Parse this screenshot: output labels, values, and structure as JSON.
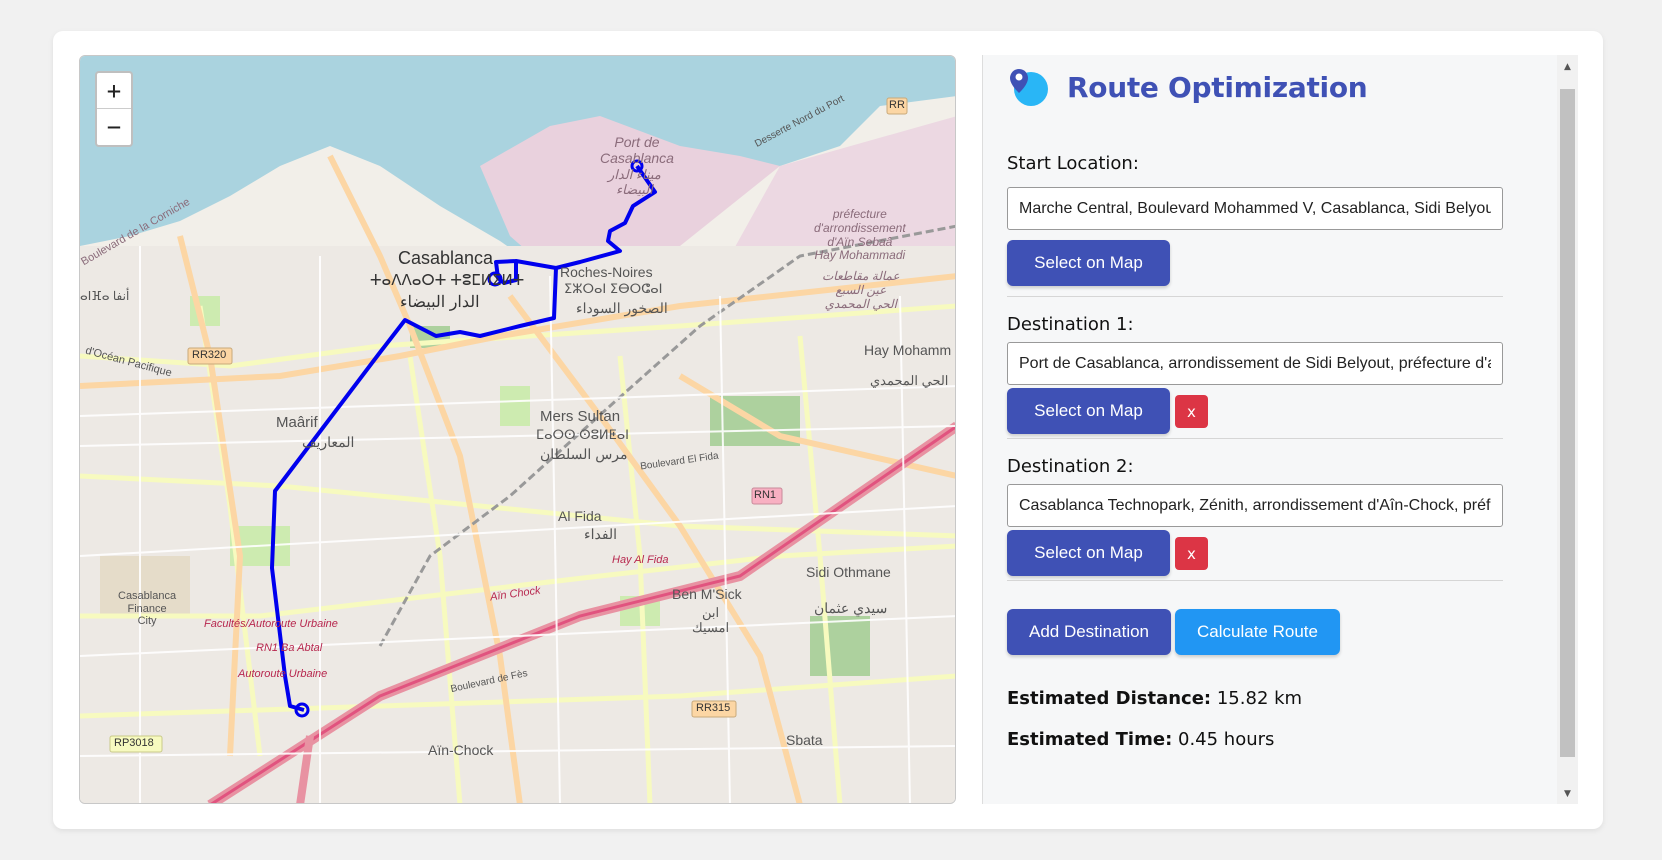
{
  "app": {
    "title": "Route Optimization",
    "accent_color": "#3f51b5",
    "secondary_color": "#2196f3",
    "danger_color": "#dc3545"
  },
  "map": {
    "zoom_in_label": "+",
    "zoom_out_label": "−",
    "route_color": "#0000ee",
    "labels": {
      "casablanca": "Casablanca",
      "casablanca_tifinagh": "ⵜⴰⴷⴷⴰⵔⵜ ⵜⵓⵎⵍⵉⵍⵜ",
      "casablanca_arabic": "الدار البيضاء",
      "port": "Port de\nCasablanca",
      "port_arabic": "ميناء الدار\nالبيضاء",
      "roches_noires": "Roches-Noires",
      "roches_tifinagh": "ⵉⵣⵔⴰⵏ ⵉⴱⵔⵛⴰⵏ",
      "roches_arabic": "الصخور السوداء",
      "mers_sultan": "Mers Sultan",
      "mers_tifinagh": "ⵎⴰⵔⵙ ⵙⵓⵍⵟⴰⵏ",
      "mers_arabic": "مرس السلطان",
      "maarif": "Maârif",
      "maarif_arabic": "المعاريف",
      "al_fida": "Al Fida",
      "al_fida_arabic": "الفداء",
      "ben_msick": "Ben M'Sick",
      "ben_msick_arabic": "ابن\nامسيك",
      "sidi_othmane": "Sidi Othmane",
      "sidi_othmane_arabic": "سيدي عثمان",
      "hay_mohammadi": "Hay Mohamm",
      "hay_mohammadi_arabic": "الحي المحمدي",
      "prefecture": "préfecture\nd'arrondissement\nd'Aïn Sebaâ\nHay Mohammadi",
      "prefecture_arabic": "عمالة مقاطعات\nعين السبع\nالحي المحمدي",
      "casablanca_finance": "Casablanca\nFinance\nCity",
      "ain_chock": "Aïn-Chock",
      "sbata": "Sbata",
      "rr320": "RR320",
      "rn1": "RN1",
      "rr315": "RR315",
      "rp3018": "RP3018",
      "rr": "RR",
      "ocean": "d'Océan Pacifique",
      "corniche": "Boulevard de la Corniche",
      "facultes": "Facultés/Autoroute Urbaine",
      "rn1_ba_abtal": "RN1 Ba Abtal",
      "autoroute": "Autoroute Urbaine",
      "ain_chock_road": "Aïn Chock",
      "hay_al_fida": "Hay Al Fida",
      "blvd_fes": "Boulevard de Fès",
      "desserte": "Desserte Nord du Port",
      "blvd_el_fida": "Boulevard El Fida",
      "anfa": "ⴰⵏⴼⴰ أنفا"
    }
  },
  "form": {
    "start": {
      "label": "Start Location:",
      "value": "Marche Central, Boulevard Mohammed V, Casablanca, Sidi Belyout"
    },
    "destinations": [
      {
        "label": "Destination 1:",
        "value": "Port de Casablanca, arrondissement de Sidi Belyout, préfecture d'arrondissement"
      },
      {
        "label": "Destination 2:",
        "value": "Casablanca Technopark, Zénith, arrondissement d'Aîn-Chock, préfecture"
      }
    ],
    "select_on_map_label": "Select on Map",
    "remove_label": "x",
    "add_destination_label": "Add Destination",
    "calculate_route_label": "Calculate Route"
  },
  "results": {
    "distance_label": "Estimated Distance:",
    "distance_value": "15.82 km",
    "time_label": "Estimated Time:",
    "time_value": "0.45 hours"
  },
  "scrollbar": {
    "up_arrow": "▲",
    "down_arrow": "▼"
  }
}
